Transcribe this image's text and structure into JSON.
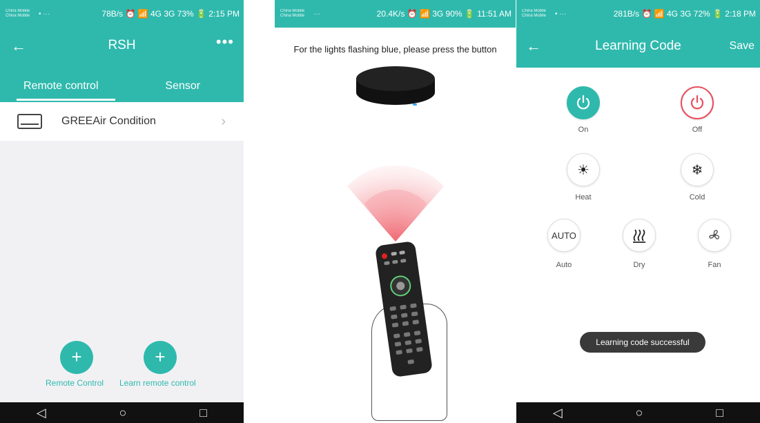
{
  "screen1": {
    "status": {
      "carrier1": "China Mobile",
      "carrier2": "China Mobile",
      "dots": "•  ···",
      "right": "78B/s ⏰ 📶 4G 3G 73% 🔋 2:15 PM"
    },
    "appbar": {
      "title": "RSH",
      "more": "•••"
    },
    "tabs": [
      {
        "label": "Remote control"
      },
      {
        "label": "Sensor"
      }
    ],
    "device": {
      "name": "GREEAir Condition"
    },
    "actions": [
      {
        "label": "Remote Control"
      },
      {
        "label": "Learn remote control"
      }
    ],
    "nav": {
      "back": "◁",
      "home": "○",
      "recent": "□"
    }
  },
  "screen2": {
    "status": {
      "carrier1": "China Mobile",
      "carrier2": "China Mobile",
      "dots": "···",
      "right": "20.4K/s ⏰ 📶 3G 90% 🔋 11:51 AM"
    },
    "instruction": "For the lights flashing blue, please press the button"
  },
  "screen3": {
    "status": {
      "carrier1": "China Mobile",
      "carrier2": "China Mobile",
      "dots": "•  ···",
      "right": "281B/s ⏰ 📶 4G 3G 72% 🔋 2:18 PM"
    },
    "appbar": {
      "title": "Learning Code",
      "save": "Save"
    },
    "modes": {
      "on": "On",
      "off": "Off",
      "heat": "Heat",
      "cold": "Cold",
      "auto": "Auto",
      "auto_btn": "AUTO",
      "dry": "Dry",
      "fan": "Fan"
    },
    "toast": "Learning code successful",
    "nav": {
      "back": "◁",
      "home": "○",
      "recent": "□"
    }
  },
  "colors": {
    "accent": "#2fb9ad",
    "off_red": "#e84d5b"
  }
}
